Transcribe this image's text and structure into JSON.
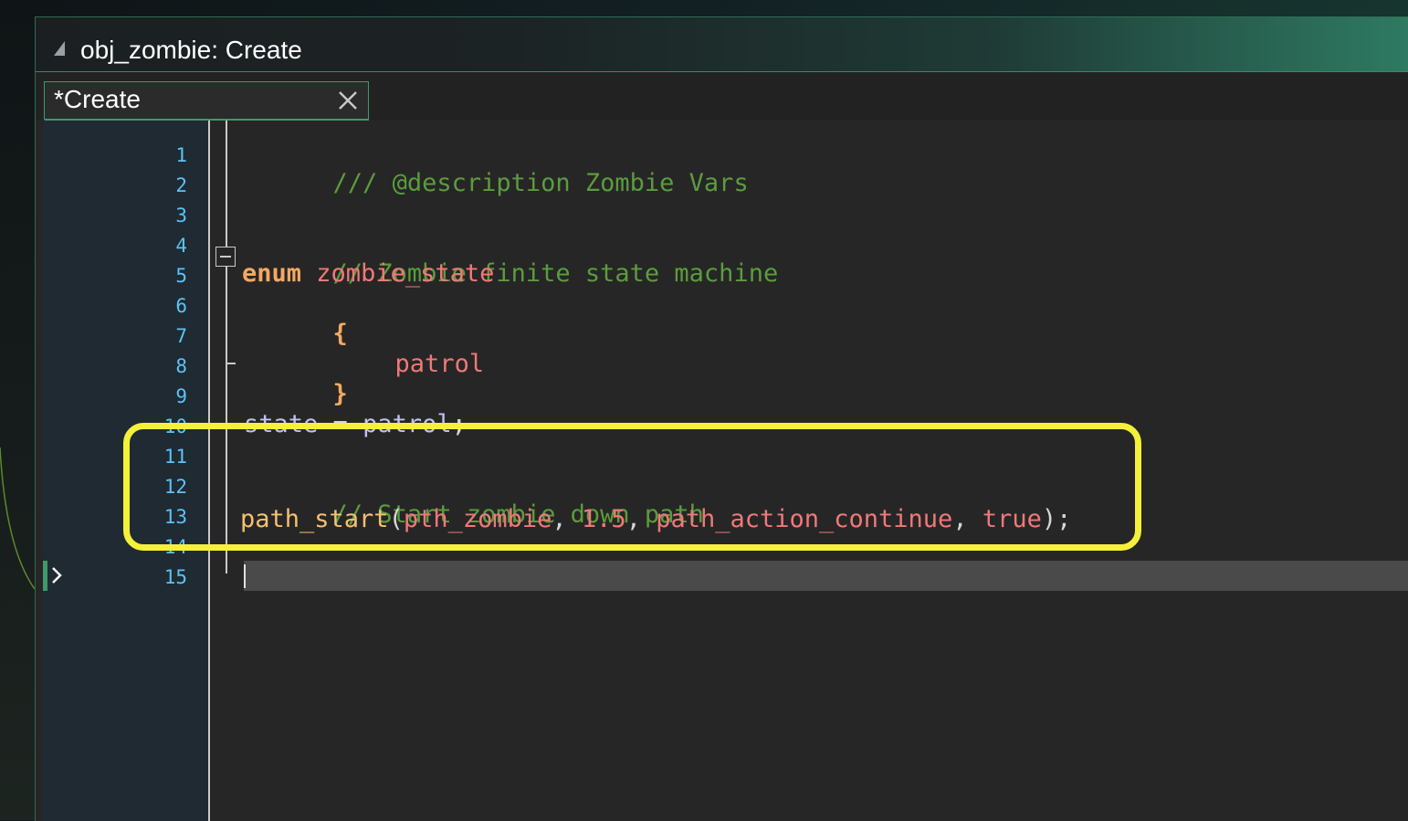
{
  "window": {
    "title": "obj_zombie: Create"
  },
  "tabs": [
    {
      "label": "*Create",
      "modified": true,
      "active": true
    }
  ],
  "editor": {
    "line_numbers": [
      "1",
      "2",
      "3",
      "4",
      "5",
      "6",
      "7",
      "8",
      "9",
      "10",
      "11",
      "12",
      "13",
      "14",
      "15"
    ],
    "current_line": "15",
    "lines": {
      "l1": {
        "comment": "/// @description Zombie Vars"
      },
      "l4": {
        "comment": "// Zombie finite state machine"
      },
      "l5": {
        "keyword": "enum",
        "name": "zombie_state"
      },
      "l6": {
        "brace": "{"
      },
      "l7": {
        "value": "patrol"
      },
      "l8": {
        "brace": "}"
      },
      "l10": {
        "var": "state",
        "op": " = ",
        "value": "patrol",
        "end": ";"
      },
      "l12": {
        "comment": "// Start zombie down path"
      },
      "l13": {
        "func": "path_start",
        "open": "(",
        "arg1": "pth_zombie",
        "sep1": ", ",
        "arg2": "1.5",
        "sep2": ", ",
        "arg3": "path_action_continue",
        "sep3": ", ",
        "arg4": "true",
        "close": ");"
      }
    }
  },
  "colors": {
    "comment": "#5b9c3e",
    "keyword": "#f5a860",
    "identifier": "#f07878",
    "variable": "#bfbfff",
    "function": "#f5c070",
    "line_number": "#5cc3f5",
    "highlight": "#f5f03a",
    "accent": "#3f9a6a"
  },
  "icons": {
    "grip": "resize-grip-icon",
    "close": "close-icon",
    "fold": "fold-collapse-icon",
    "current": "current-line-arrow-icon"
  }
}
